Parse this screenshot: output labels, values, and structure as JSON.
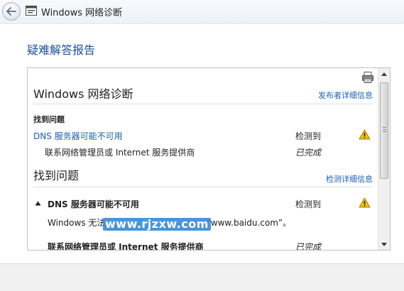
{
  "window": {
    "title": "Windows 网络诊断",
    "icons": [
      "back-arrow-icon",
      "network-diagnostics-icon"
    ]
  },
  "page": {
    "heading": "疑难解答报告"
  },
  "report": {
    "section_title": "Windows 网络诊断",
    "publisher_link": "发布者详细信息",
    "found_label": "找到问题",
    "problem_1": {
      "title": "DNS 服务器可能不可用",
      "status": "检测到",
      "sub_item": "联系网络管理员或 Internet 服务提供商",
      "sub_status": "已完成"
    },
    "found_label_2": "找到问题",
    "detect_link": "检测详细信息",
    "problem_2": {
      "title": "DNS 服务器可能不可用",
      "status": "检测到",
      "description_prefix": "Windows 无法",
      "description_suffix": "“www.baidu.com”。",
      "next_item": "联系网络管理员或 Internet 服务提供商",
      "next_status": "已完成"
    },
    "watermark": "www.rjzxw.com"
  },
  "colors": {
    "link": "#1a5fb4",
    "heading": "#1a4f9c",
    "warning": "#f2c200"
  }
}
